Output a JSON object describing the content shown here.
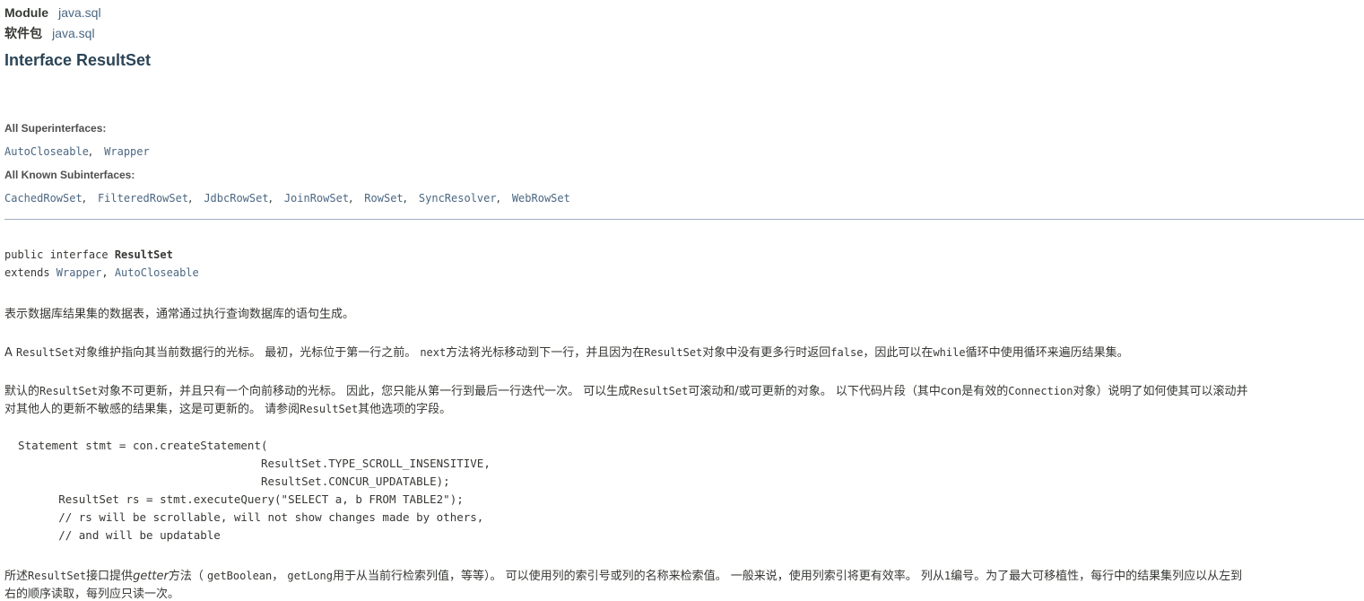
{
  "header": {
    "module_label": "Module",
    "module_name": "java.sql",
    "package_label": "软件包",
    "package_name": "java.sql",
    "title": "Interface ResultSet"
  },
  "superinterfaces": {
    "label": "All Superinterfaces:",
    "items": [
      "AutoCloseable",
      "Wrapper"
    ],
    "separator": ","
  },
  "subinterfaces": {
    "label": "All Known Subinterfaces:",
    "items": [
      "CachedRowSet",
      "FilteredRowSet",
      "JdbcRowSet",
      "JoinRowSet",
      "RowSet",
      "SyncResolver",
      "WebRowSet"
    ],
    "separator": ","
  },
  "signature": {
    "line1_prefix": "public interface ",
    "line1_name": "ResultSet",
    "line2_prefix": "extends ",
    "ext1": "Wrapper",
    "comma": ", ",
    "ext2": "AutoCloseable"
  },
  "description": {
    "p1": "表示数据库结果集的数据表，通常通过执行查询数据库的语句生成。",
    "p2": {
      "a": "A ",
      "c1": "ResultSet",
      "b": "对象维护指向其当前数据行的光标。 最初，光标位于第一行之前。 ",
      "c2": "next",
      "c": "方法将光标移动到下一行，并且因为在",
      "c3": "ResultSet",
      "d": "对象中没有更多行时返回",
      "c4": "false",
      "e": "，因此可以在",
      "c5": "while",
      "f": "循环中使用循环来遍历结果集。"
    },
    "p3": {
      "a": "默认的",
      "c1": "ResultSet",
      "b": "对象不可更新，并且只有一个向前移动的光标。 因此，您只能从第一行到最后一行迭代一次。 可以生成",
      "c2": "ResultSet",
      "c": "可滚动和/或可更新的对象。 以下代码片段（其中",
      "c3": "con",
      "d": "是有效的",
      "c4": "Connection",
      "e": "对象）说明了如何使其可以滚动并",
      "line2_a": "对其他人的更新不敏感的结果集，这是可更新的。 请参阅",
      "c5": "ResultSet",
      "line2_b": "其他选项的字段。"
    },
    "code": [
      "  Statement stmt = con.createStatement(",
      "                                      ResultSet.TYPE_SCROLL_INSENSITIVE,",
      "                                      ResultSet.CONCUR_UPDATABLE);",
      "        ResultSet rs = stmt.executeQuery(\"SELECT a, b FROM TABLE2\");",
      "        // rs will be scrollable, will not show changes made by others,",
      "        // and will be updatable"
    ],
    "p4": {
      "a": "所述",
      "c1": "ResultSet",
      "b": "接口提供",
      "getter": "getter",
      "c": "方法（ ",
      "c2": "getBoolean",
      "d": "， ",
      "c3": "getLong",
      "e": "用于从当前行检索列值，等等）。 可以使用列的索引号或列的名称来检索值。 一般来说，使用列索引将更有效率。 列从",
      "c4": "1",
      "f": "编号。为了最大可移植性，每行中的结果集列应以从左到",
      "line2": "右的顺序读取，每列应只读一次。"
    }
  }
}
